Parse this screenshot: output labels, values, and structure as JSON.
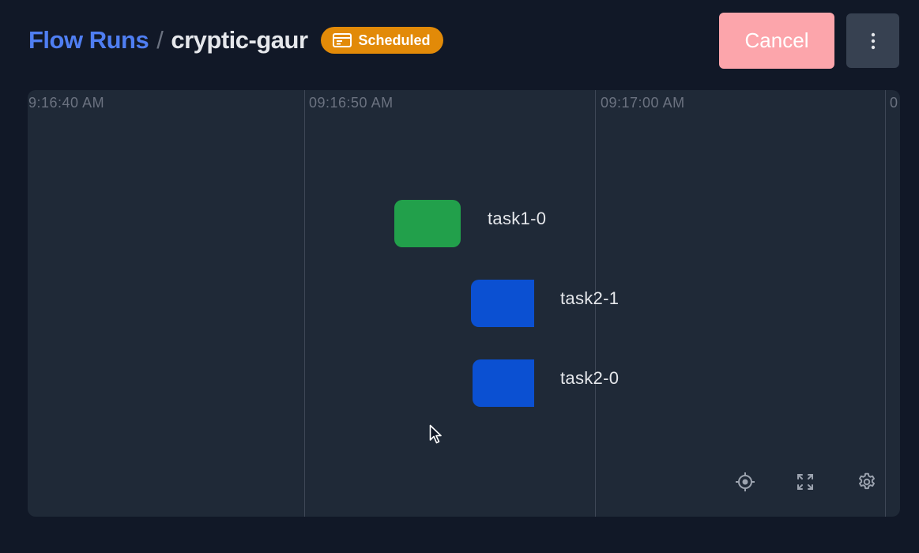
{
  "header": {
    "breadcrumb_root": "Flow Runs",
    "separator": "/",
    "run_name": "cryptic-gaur",
    "status_badge": {
      "label": "Scheduled",
      "icon": "calendar-icon",
      "color": "#e28a08"
    },
    "cancel_label": "Cancel",
    "menu_icon": "vertical-dots-icon"
  },
  "timeline": {
    "ticks": [
      "9:16:40 AM",
      "09:16:50 AM",
      "09:17:00 AM",
      "0"
    ],
    "tasks": [
      {
        "name": "task1-0",
        "state_color": "#22a04b"
      },
      {
        "name": "task2-1",
        "state_color": "#0b50d2"
      },
      {
        "name": "task2-0",
        "state_color": "#0b50d2"
      }
    ],
    "controls": [
      "recenter-icon",
      "fullscreen-icon",
      "settings-icon"
    ]
  },
  "colors": {
    "background": "#111827",
    "panel": "#1f2937",
    "link": "#4f7ef2",
    "cancel": "#fca5ab"
  }
}
